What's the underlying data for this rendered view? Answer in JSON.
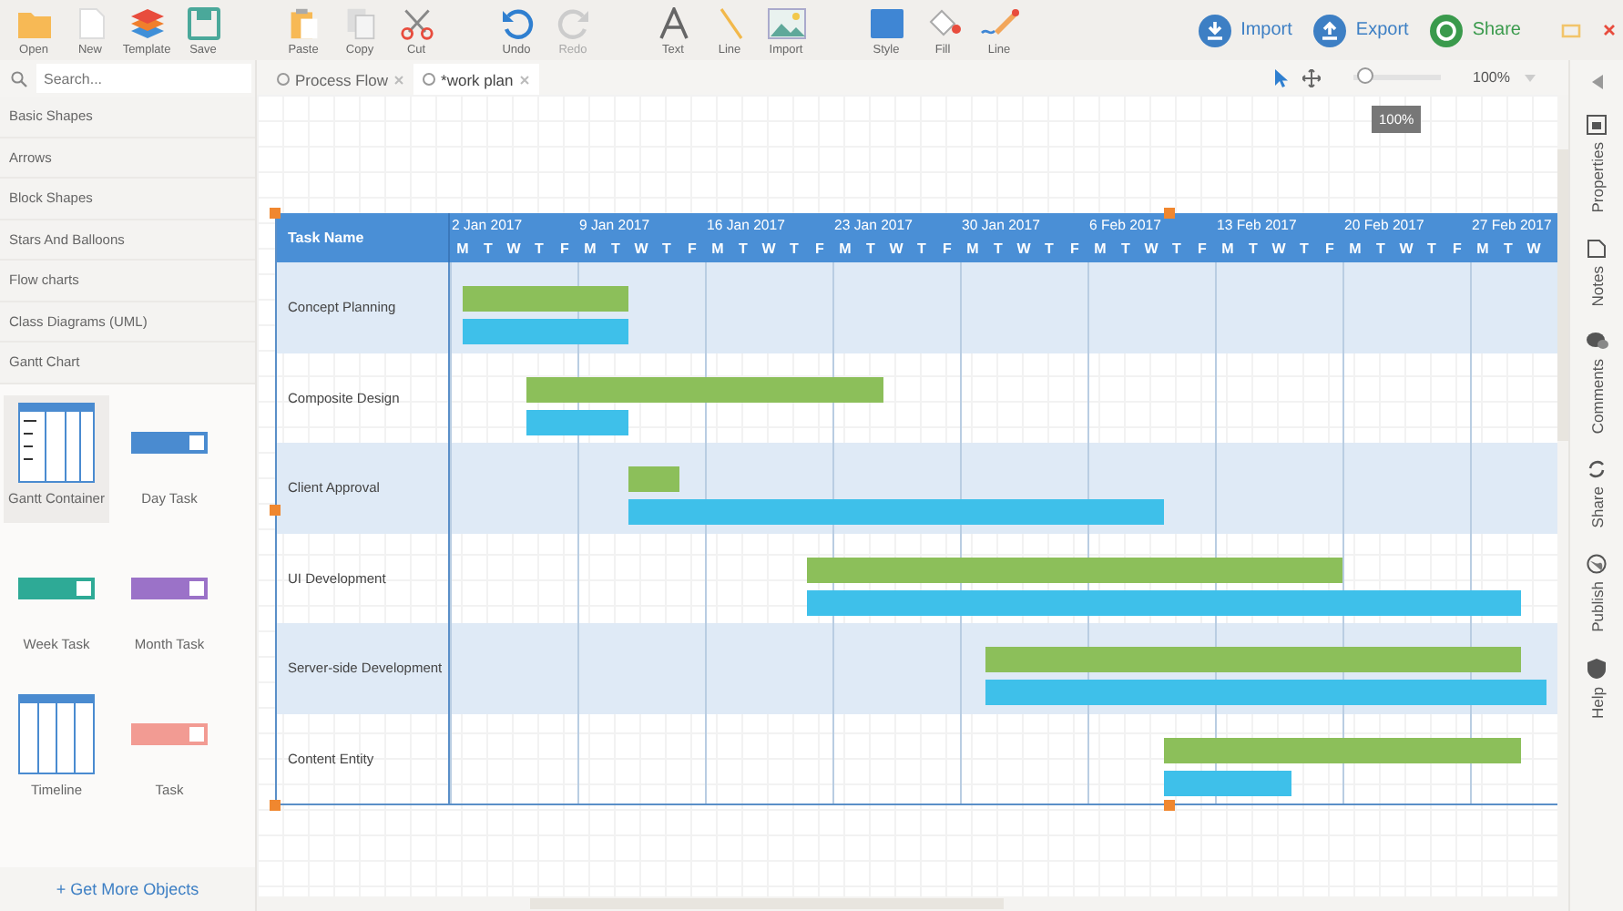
{
  "toolbar": {
    "groups": [
      [
        {
          "label": "Open",
          "disabled": false
        },
        {
          "label": "New",
          "disabled": false
        },
        {
          "label": "Template",
          "disabled": false
        },
        {
          "label": "Save",
          "disabled": false
        }
      ],
      [
        {
          "label": "Paste",
          "disabled": false
        },
        {
          "label": "Copy",
          "disabled": false
        },
        {
          "label": "Cut",
          "disabled": false
        }
      ],
      [
        {
          "label": "Undo",
          "disabled": false
        },
        {
          "label": "Redo",
          "disabled": true
        }
      ],
      [
        {
          "label": "Text",
          "disabled": false
        },
        {
          "label": "Line",
          "disabled": false
        },
        {
          "label": "Import",
          "disabled": false
        }
      ],
      [
        {
          "label": "Style",
          "disabled": false
        },
        {
          "label": "Fill",
          "disabled": false
        },
        {
          "label": "Line",
          "disabled": false
        }
      ]
    ],
    "actions": [
      {
        "label": "Import",
        "color": "#3d7fc4"
      },
      {
        "label": "Export",
        "color": "#3d7fc4"
      },
      {
        "label": "Share",
        "color": "#3a9a4c"
      }
    ]
  },
  "sidebar": {
    "search": {
      "placeholder": "Search..."
    },
    "categories": [
      {
        "label": "Basic Shapes"
      },
      {
        "label": "Arrows"
      },
      {
        "label": "Block Shapes"
      },
      {
        "label": "Stars And Balloons"
      },
      {
        "label": "Flow charts"
      },
      {
        "label": "Class Diagrams (UML)"
      },
      {
        "label": "Gantt Chart"
      }
    ],
    "shapes": [
      {
        "label": "Gantt Container",
        "kind": "container",
        "selected": true
      },
      {
        "label": "Day Task",
        "kind": "bar",
        "color": "#4a8bd0",
        "selected": false
      },
      {
        "label": "Week Task",
        "kind": "bar",
        "color": "#2eaa96",
        "selected": false
      },
      {
        "label": "Month Task",
        "kind": "bar",
        "color": "#9b72c8",
        "selected": false
      },
      {
        "label": "Timeline",
        "kind": "timeline",
        "selected": false
      },
      {
        "label": "Task",
        "kind": "bar",
        "color": "#f29b93",
        "selected": false
      }
    ],
    "more_link": "+ Get More Objects"
  },
  "doc_tabs": [
    {
      "label": "Process Flow",
      "selected": false
    },
    {
      "label": "*work plan",
      "selected": true
    }
  ],
  "zoom": {
    "level": 0.05,
    "value": "100%",
    "tooltip": "100%"
  },
  "gantt": {
    "name_header": "Task Name",
    "weeks": [
      {
        "label": "2 Jan 2017",
        "days": [
          "M",
          "T",
          "W",
          "T",
          "F"
        ]
      },
      {
        "label": "9 Jan 2017",
        "days": [
          "M",
          "T",
          "W",
          "T",
          "F"
        ]
      },
      {
        "label": "16 Jan 2017",
        "days": [
          "M",
          "T",
          "W",
          "T",
          "F"
        ]
      },
      {
        "label": "23 Jan 2017",
        "days": [
          "M",
          "T",
          "W",
          "T",
          "F"
        ]
      },
      {
        "label": "30 Jan 2017",
        "days": [
          "M",
          "T",
          "W",
          "T",
          "F"
        ]
      },
      {
        "label": "6 Feb 2017",
        "days": [
          "M",
          "T",
          "W",
          "T",
          "F"
        ]
      },
      {
        "label": "13 Feb 2017",
        "days": [
          "M",
          "T",
          "W",
          "T",
          "F"
        ]
      },
      {
        "label": "20 Feb 2017",
        "days": [
          "M",
          "T",
          "W",
          "T",
          "F"
        ]
      },
      {
        "label": "27 Feb 2017",
        "days": [
          "M",
          "T",
          "W"
        ]
      }
    ],
    "tasks": [
      {
        "name": "Concept Planning"
      },
      {
        "name": "Composite Design"
      },
      {
        "name": "Client Approval"
      },
      {
        "name": "UI Development"
      },
      {
        "name": "Server-side Development"
      },
      {
        "name": "Content Entity"
      }
    ]
  },
  "right_panel": {
    "tabs": [
      {
        "label": "Properties",
        "selected": false
      },
      {
        "label": "Notes",
        "selected": false
      },
      {
        "label": "Comments",
        "selected": false
      },
      {
        "label": "Share",
        "selected": false
      },
      {
        "label": "Publish",
        "selected": false
      },
      {
        "label": "Help",
        "selected": false
      }
    ]
  }
}
